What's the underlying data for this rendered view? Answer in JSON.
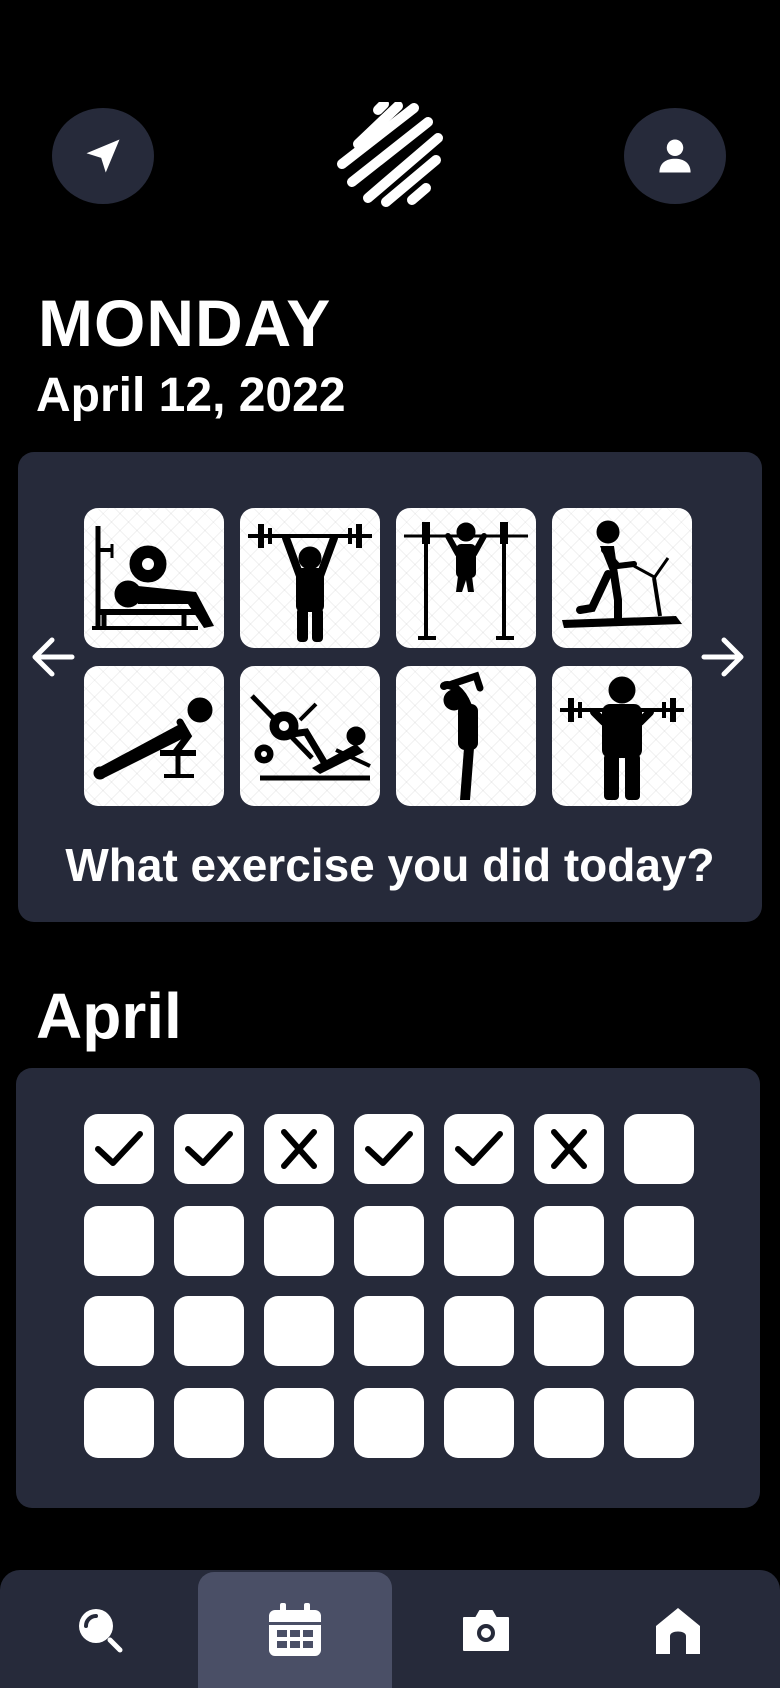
{
  "header": {
    "left_icon": "navigation-arrow-icon",
    "logo_icon": "diagonal-stripes-logo",
    "right_icon": "user-icon"
  },
  "date": {
    "weekday": "MONDAY",
    "full": "April 12, 2022"
  },
  "exercise_picker": {
    "question": "What exercise you did today?",
    "prev_icon": "arrow-left-icon",
    "next_icon": "arrow-right-icon",
    "items": [
      {
        "icon": "bench-press-icon"
      },
      {
        "icon": "overhead-press-icon"
      },
      {
        "icon": "pull-up-icon"
      },
      {
        "icon": "treadmill-icon"
      },
      {
        "icon": "incline-push-up-icon"
      },
      {
        "icon": "leg-press-icon"
      },
      {
        "icon": "stretching-icon"
      },
      {
        "icon": "barbell-curl-icon"
      }
    ]
  },
  "calendar": {
    "month": "April",
    "days": [
      "done",
      "done",
      "missed",
      "done",
      "done",
      "missed",
      "empty",
      "empty",
      "empty",
      "empty",
      "empty",
      "empty",
      "empty",
      "empty",
      "empty",
      "empty",
      "empty",
      "empty",
      "empty",
      "empty",
      "empty",
      "empty",
      "empty",
      "empty",
      "empty",
      "empty",
      "empty",
      "empty"
    ]
  },
  "bottom_nav": {
    "active": "calendar",
    "items": [
      {
        "id": "search",
        "icon": "search-icon"
      },
      {
        "id": "calendar",
        "icon": "calendar-icon"
      },
      {
        "id": "camera",
        "icon": "camera-icon"
      },
      {
        "id": "home",
        "icon": "home-icon"
      }
    ]
  },
  "colors": {
    "background": "#000000",
    "panel": "#262a3a",
    "active_nav": "#4a4f66",
    "text": "#ffffff"
  }
}
